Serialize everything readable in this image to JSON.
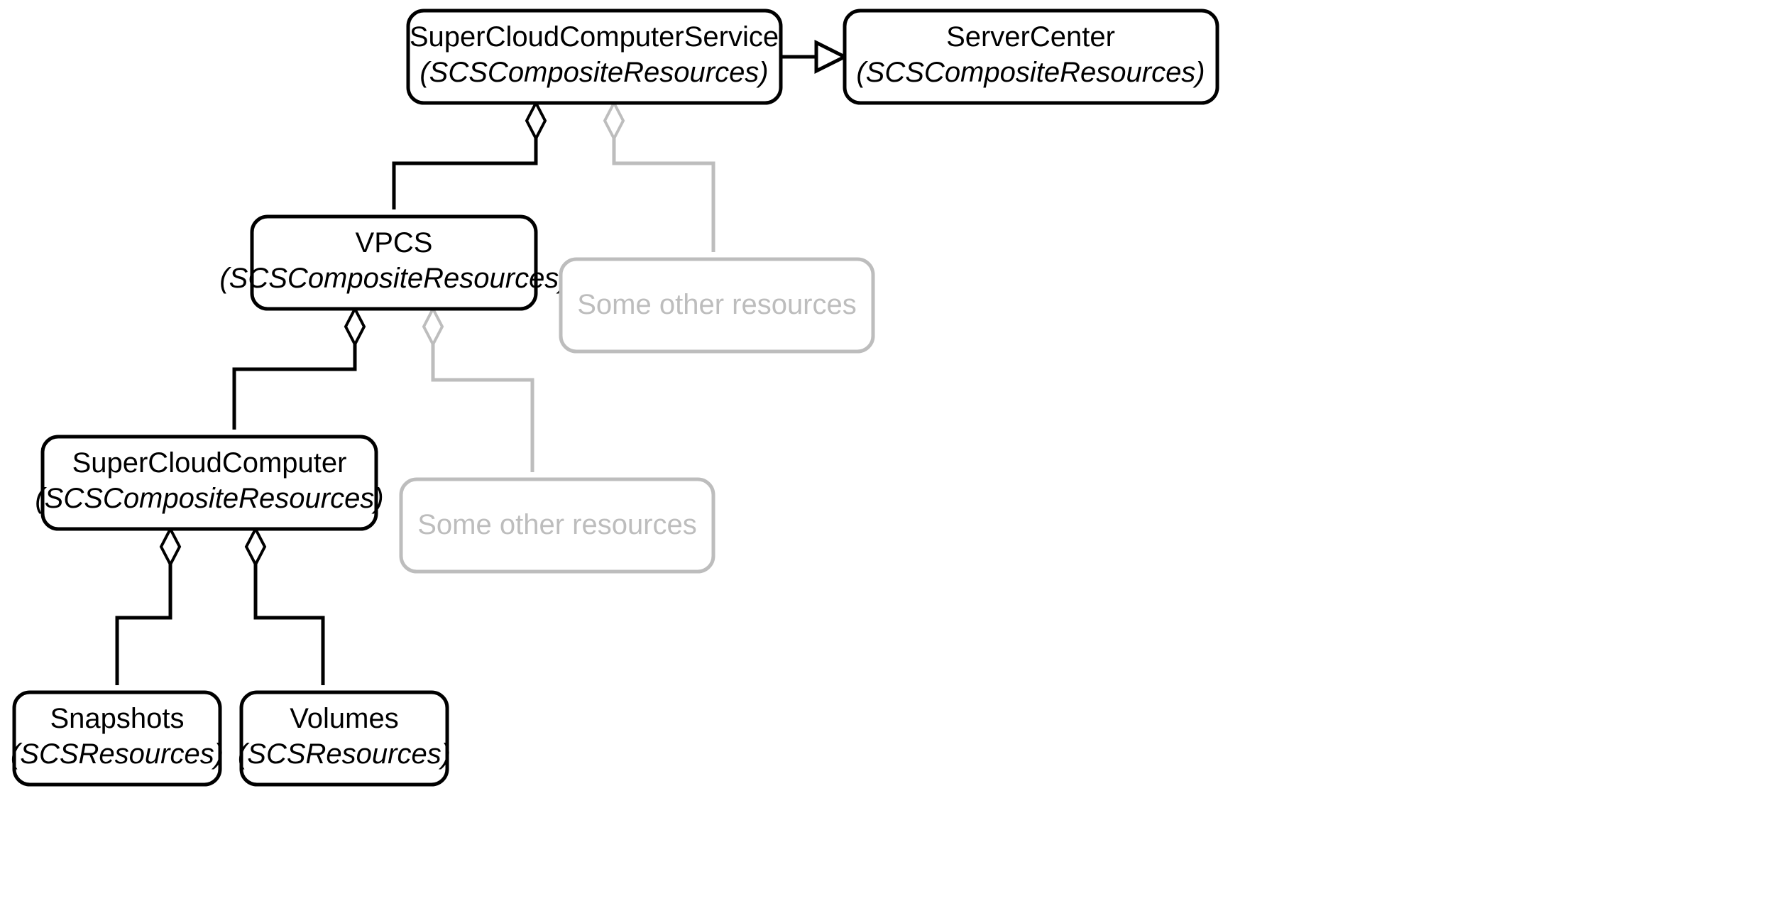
{
  "nodes": {
    "scs_service": {
      "title": "SuperCloudComputerService",
      "subtitle": "(SCSCompositeResources)"
    },
    "server_center": {
      "title": "ServerCenter",
      "subtitle": "(SCSCompositeResources)"
    },
    "vpcs": {
      "title": "VPCS",
      "subtitle": "(SCSCompositeResources)"
    },
    "other1": {
      "label": "Some other resources"
    },
    "scc": {
      "title": "SuperCloudComputer",
      "subtitle": "(SCSCompositeResources)"
    },
    "other2": {
      "label": "Some other resources"
    },
    "snapshots": {
      "title": "Snapshots",
      "subtitle": "(SCSResources)"
    },
    "volumes": {
      "title": "Volumes",
      "subtitle": "(SCSResources)"
    }
  }
}
